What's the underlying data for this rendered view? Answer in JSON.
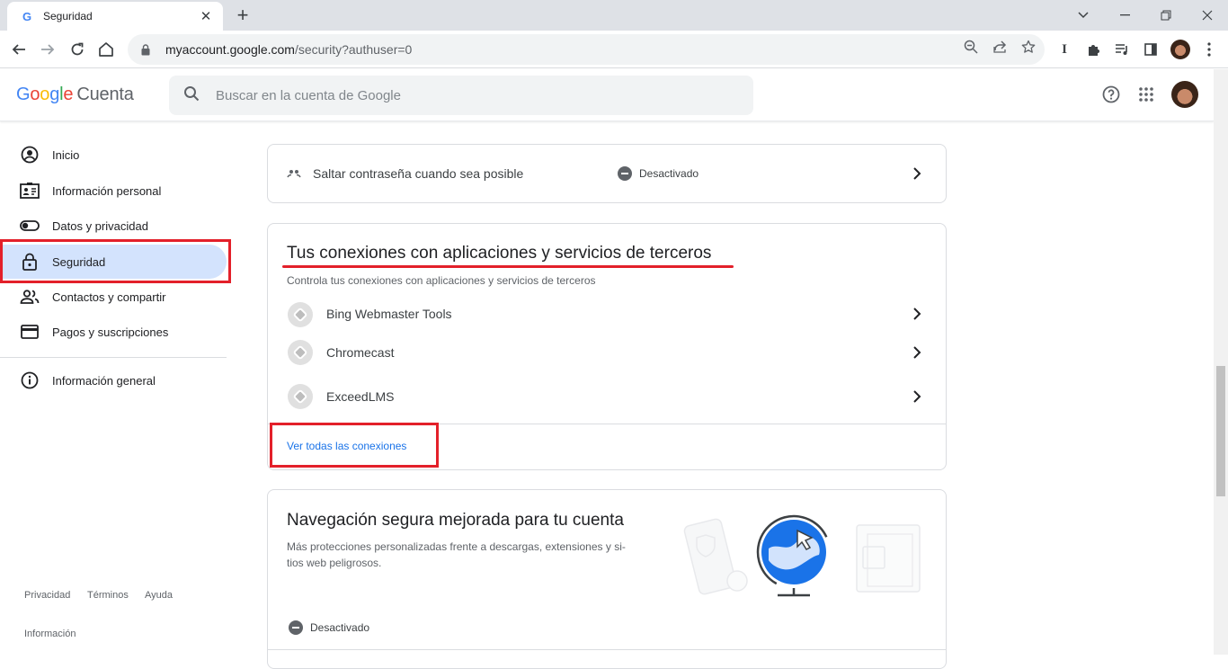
{
  "browser": {
    "tab_title": "Seguridad",
    "url_host": "myaccount.google.com",
    "url_path": "/security?authuser=0"
  },
  "header": {
    "logo_letters": [
      "G",
      "o",
      "o",
      "g",
      "l",
      "e"
    ],
    "product": "Cuenta",
    "search_placeholder": "Buscar en la cuenta de Google"
  },
  "sidebar": {
    "items": [
      {
        "label": "Inicio",
        "icon": "account-circle-icon"
      },
      {
        "label": "Información personal",
        "icon": "id-card-icon"
      },
      {
        "label": "Datos y privacidad",
        "icon": "toggle-icon"
      },
      {
        "label": "Seguridad",
        "icon": "lock-icon",
        "active": true
      },
      {
        "label": "Contactos y compartir",
        "icon": "people-icon"
      },
      {
        "label": "Pagos y suscripciones",
        "icon": "credit-card-icon"
      }
    ],
    "general": {
      "label": "Información general",
      "icon": "info-icon"
    },
    "footer": {
      "privacy": "Privacidad",
      "terms": "Términos",
      "help": "Ayuda",
      "info": "Información"
    }
  },
  "skip_password": {
    "label": "Saltar contraseña cuando sea posible",
    "status": "Desactivado"
  },
  "connections": {
    "title": "Tus conexiones con aplicaciones y servicios de terceros",
    "subtitle": "Controla tus conexiones con aplicaciones y servicios de terceros",
    "apps": [
      "Bing Webmaster Tools",
      "Chromecast",
      "ExceedLMS"
    ],
    "see_all": "Ver todas las conexiones"
  },
  "safe_browsing": {
    "title": "Navegación segura mejorada para tu cuenta",
    "desc_line1": "Más protecciones personalizadas frente a descargas, extensiones y si-",
    "desc_line2": "tios web peligrosos.",
    "status": "Desactivado"
  },
  "colors": {
    "accent": "#1a73e8",
    "active_nav": "#d3e3fd",
    "annotation_red": "#e3202a"
  }
}
